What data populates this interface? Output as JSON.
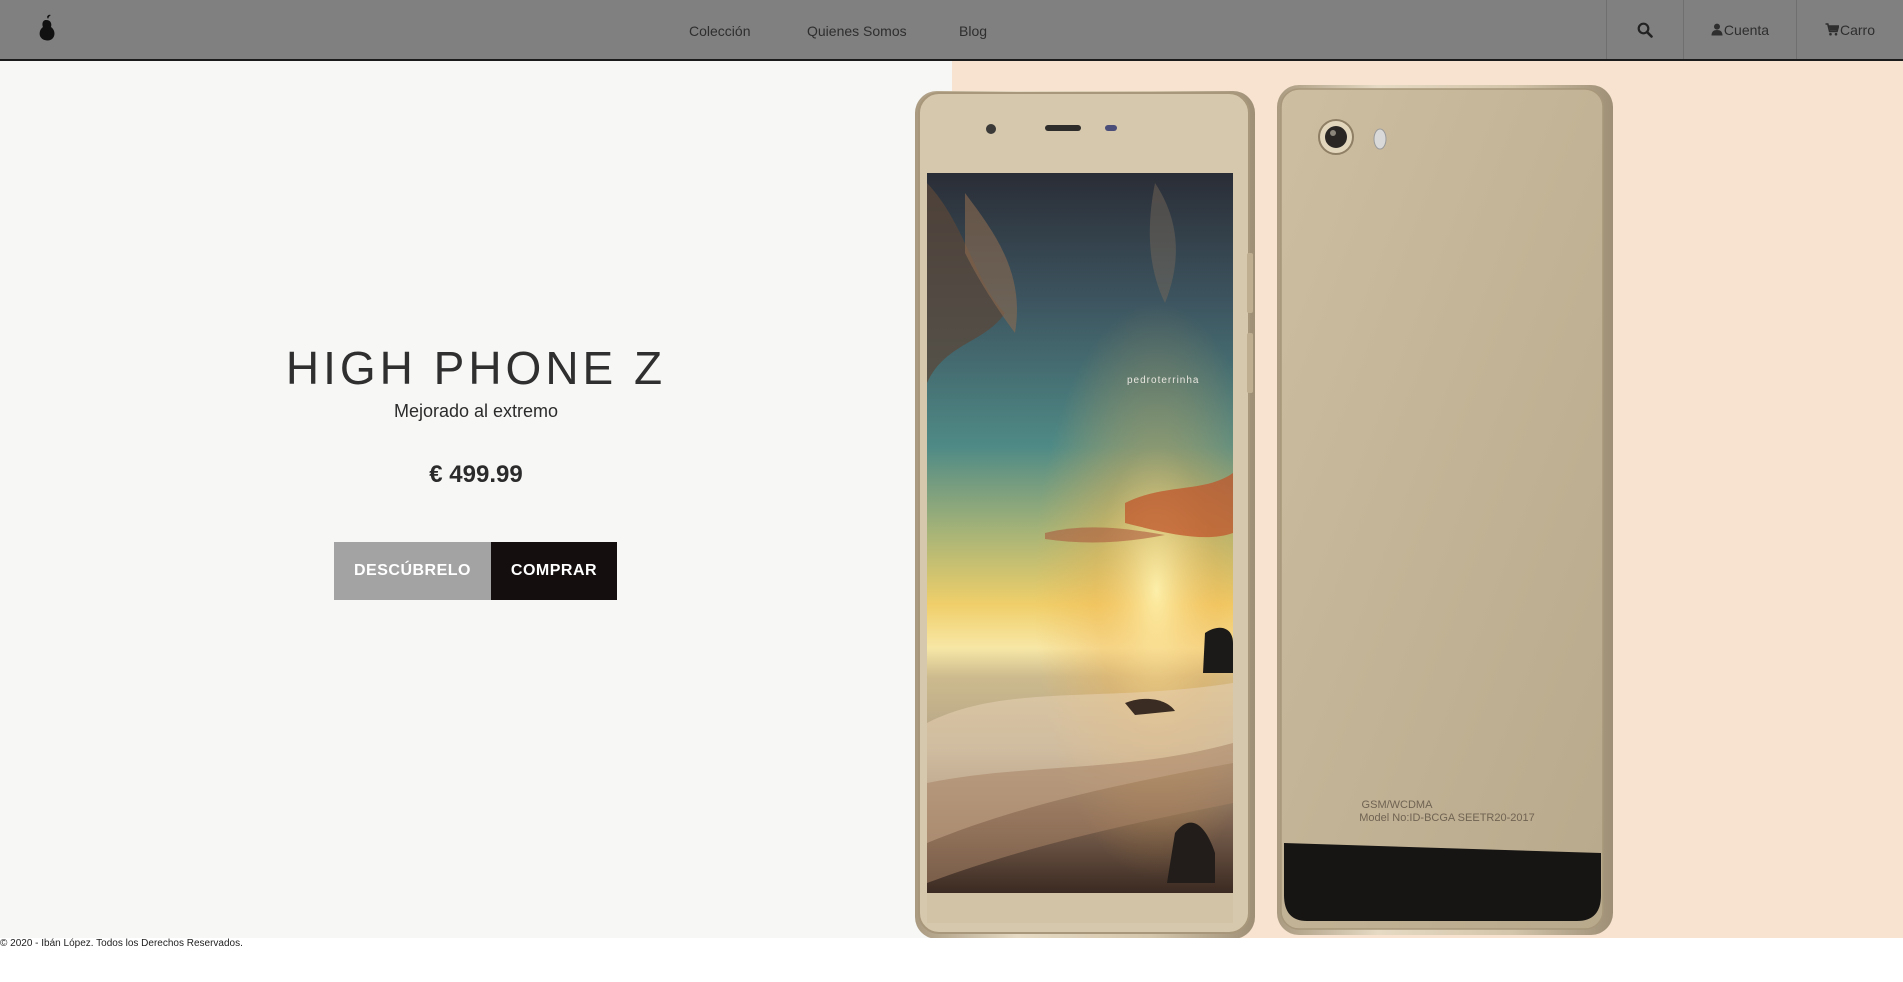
{
  "nav": {
    "links": [
      "Colección",
      "Quienes Somos",
      "Blog"
    ],
    "account_label": "Cuenta",
    "cart_label": "Carro",
    "icons": {
      "brand": "pear-logo-icon",
      "search": "search-icon",
      "account": "user-icon",
      "cart": "cart-icon"
    }
  },
  "hero": {
    "title": "HIGH PHONE Z",
    "subtitle": "Mejorado al extremo",
    "price": "€ 499.99",
    "discover_label": "DESCÚBRELO",
    "buy_label": "COMPRAR",
    "phone_back_text": {
      "line1": "GSM/WCDMA",
      "line2": "Model No:ID-BCGA SEETR20-2017"
    },
    "screen_watermark": "pedroterrinha"
  },
  "footer": {
    "copyright": "© 2020 - Ibán López. Todos los Derechos Reservados."
  },
  "colors": {
    "navbar": "#808080",
    "hero_left": "#f7f7f5",
    "hero_right": "#f8e3d0",
    "discover_button": "#a3a3a3",
    "buy_button": "#140f0e",
    "phone_gold": "#c9b89c"
  }
}
